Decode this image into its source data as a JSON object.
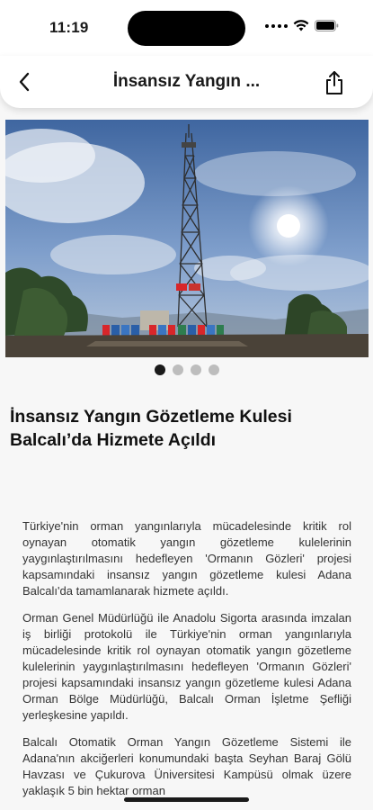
{
  "status_bar": {
    "time": "11:19"
  },
  "header": {
    "title": "İnsansız Yangın ...",
    "back_icon": "chevron-left-icon",
    "share_icon": "share-icon"
  },
  "carousel": {
    "page_count": 4,
    "active_index": 0
  },
  "article": {
    "headline": "İnsansız Yangın Gözetleme Kulesi Balcalı’da Hizmete Açıldı",
    "paragraphs": [
      "Türkiye'nin orman yangınlarıyla mücadelesinde kritik rol oynayan otomatik yangın gözetleme kulelerinin yaygınlaştırılmasını hedefleyen 'Ormanın Gözleri' projesi kapsamındaki insansız yangın gözetleme kulesi Adana Balcalı'da tamamlanarak hizmete açıldı.",
      "Orman Genel Müdürlüğü ile Anadolu Sigorta arasında imzalan iş birliği protokolü ile Türkiye'nin orman yangınlarıyla mücadelesinde kritik rol oynayan otomatik yangın gözetleme kulelerinin yaygınlaştırılmasını hedefleyen 'Ormanın Gözleri' projesi kapsamındaki insansız yangın gözetleme kulesi Adana Orman Bölge Müdürlüğü, Balcalı Orman İşletme Şefliği yerleşkesine yapıldı.",
      "Balcalı Otomatik Orman Yangın Gözetleme Sistemi ile Adana'nın akciğerleri konumundaki başta Seyhan Baraj Gölü Havzası ve Çukurova Üniversitesi Kampüsü olmak üzere yaklaşık 5 bin hektar orman"
    ]
  },
  "colors": {
    "pager_active": "#1a1a1a",
    "pager_inactive": "#bdbdbd",
    "sky": "#5d84b8"
  }
}
